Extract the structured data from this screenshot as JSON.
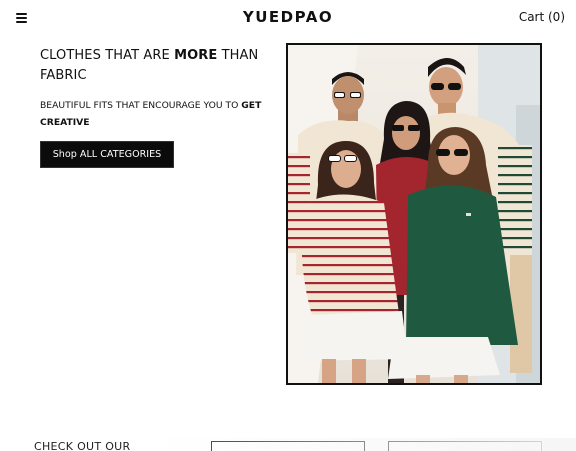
{
  "header": {
    "menu_icon": "hamburger-menu-icon",
    "brand": "YUEDPAO",
    "cart_label": "Cart (0)"
  },
  "hero": {
    "headline_pre": "CLOTHES THAT ARE ",
    "headline_bold": "MORE",
    "headline_post": " THAN FABRIC",
    "subline_pre": "BEAUTIFUL FITS THAT ENCOURAGE YOU TO ",
    "subline_bold": "GET CREATIVE",
    "cta_label": "Shop ALL CATEGORIES"
  },
  "teaser": {
    "label": "CHECK OUT OUR"
  },
  "colors": {
    "text": "#111111",
    "button_bg": "#0b0b0b",
    "button_text": "#ffffff",
    "maroon_sweater": "#a3262e",
    "green_sweater": "#1f5a40",
    "cream_sweater": "#f1e6d4"
  }
}
